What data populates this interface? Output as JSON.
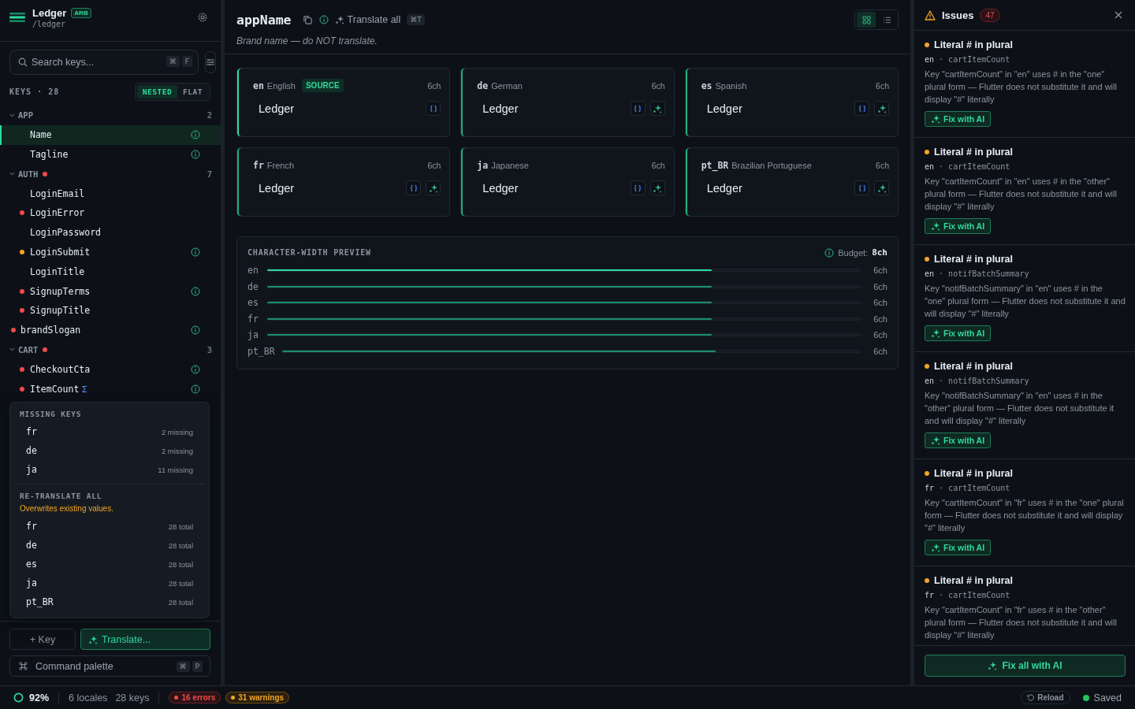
{
  "sidebar": {
    "app_name": "Ledger",
    "format_badge": "ARB",
    "path": "/ledger",
    "search": {
      "placeholder": "Search keys...",
      "shortcut": [
        "⌘",
        "F"
      ]
    },
    "keys_label": "KEYS · 28",
    "view_toggle": [
      {
        "label": "NESTED",
        "selected": true
      },
      {
        "label": "FLAT",
        "selected": false
      }
    ],
    "tree": [
      {
        "kind": "group",
        "label": "APP",
        "expanded": true,
        "count": "2",
        "children": [
          {
            "kind": "key",
            "label": "Name",
            "selected": true,
            "info": true
          },
          {
            "kind": "key",
            "label": "Tagline",
            "selected": false,
            "info": true
          }
        ]
      },
      {
        "kind": "group",
        "label": "AUTH",
        "expanded": true,
        "color": "#f04a4a",
        "count": "7",
        "children": [
          {
            "kind": "key",
            "label": "LoginEmail",
            "selected": false,
            "info": false
          },
          {
            "kind": "key",
            "label": "LoginError",
            "selected": false,
            "info": false,
            "color": "#f04a4a"
          },
          {
            "kind": "key",
            "label": "LoginPassword",
            "selected": false,
            "info": false
          },
          {
            "kind": "key",
            "label": "LoginSubmit",
            "selected": false,
            "info": true,
            "color": "#f5a524"
          },
          {
            "kind": "key",
            "label": "LoginTitle",
            "selected": false,
            "info": false
          },
          {
            "kind": "key",
            "label": "SignupTerms",
            "selected": false,
            "info": true,
            "color": "#f04a4a"
          },
          {
            "kind": "key",
            "label": "SignupTitle",
            "selected": false,
            "info": false,
            "color": "#f04a4a"
          }
        ]
      },
      {
        "kind": "key",
        "label": "brandSlogan",
        "selected": false,
        "info": true,
        "color": "#f04a4a"
      },
      {
        "kind": "group",
        "label": "CART",
        "expanded": true,
        "color": "#f04a4a",
        "count": "3",
        "children": [
          {
            "kind": "key",
            "label": "CheckoutCta",
            "selected": false,
            "info": true,
            "color": "#f04a4a"
          },
          {
            "kind": "key",
            "label": "ItemCount",
            "selected": false,
            "info": true,
            "color": "#f04a4a",
            "plural": true
          }
        ]
      }
    ],
    "translate_menu": {
      "missing_title": "MISSING KEYS",
      "missing": [
        {
          "locale": "fr",
          "note": "2 missing"
        },
        {
          "locale": "de",
          "note": "2 missing"
        },
        {
          "locale": "ja",
          "note": "11 missing"
        }
      ],
      "retranslate_title": "RE-TRANSLATE ALL",
      "warning": "Overwrites existing values.",
      "retranslate": [
        {
          "locale": "fr",
          "note": "28 total"
        },
        {
          "locale": "de",
          "note": "28 total"
        },
        {
          "locale": "es",
          "note": "28 total"
        },
        {
          "locale": "ja",
          "note": "28 total"
        },
        {
          "locale": "pt_BR",
          "note": "28 total"
        }
      ]
    },
    "add_key_button": "+ Key",
    "translate_button": "Translate...",
    "command_palette": {
      "label": "Command palette",
      "shortcut": [
        "⌘",
        "P"
      ]
    }
  },
  "main": {
    "key_name": "appName",
    "translate_all": "Translate all",
    "translate_shortcut": "⌘T",
    "description": "Brand name — do NOT translate.",
    "view_modes": [
      {
        "kind": "grid",
        "selected": true
      },
      {
        "kind": "list",
        "selected": false
      }
    ],
    "locales": [
      {
        "code": "en",
        "name": "English",
        "source": true,
        "badge": "SOURCE",
        "width": "6ch",
        "value": "Ledger"
      },
      {
        "code": "de",
        "name": "German",
        "source": false,
        "width": "6ch",
        "value": "Ledger"
      },
      {
        "code": "es",
        "name": "Spanish",
        "source": false,
        "width": "6ch",
        "value": "Ledger"
      },
      {
        "code": "fr",
        "name": "French",
        "source": false,
        "width": "6ch",
        "value": "Ledger"
      },
      {
        "code": "ja",
        "name": "Japanese",
        "source": false,
        "width": "6ch",
        "value": "Ledger"
      },
      {
        "code": "pt_BR",
        "name": "Brazilian Portuguese",
        "source": false,
        "width": "6ch",
        "value": "Ledger"
      }
    ],
    "preview": {
      "title": "CHARACTER-WIDTH PREVIEW",
      "budget_label": "Budget:",
      "budget": "8ch",
      "rows": [
        {
          "locale": "en",
          "source": true,
          "level": 0.75,
          "reading": "6ch"
        },
        {
          "locale": "de",
          "source": false,
          "level": 0.75,
          "reading": "6ch"
        },
        {
          "locale": "es",
          "source": false,
          "level": 0.75,
          "reading": "6ch"
        },
        {
          "locale": "fr",
          "source": false,
          "level": 0.75,
          "reading": "6ch"
        },
        {
          "locale": "ja",
          "source": false,
          "level": 0.75,
          "reading": "6ch"
        },
        {
          "locale": "pt_BR",
          "source": false,
          "level": 0.75,
          "reading": "6ch"
        }
      ]
    }
  },
  "issues": {
    "title": "Issues",
    "count": "47",
    "separator": "·",
    "items": [
      {
        "color": "#f5a524",
        "title": "Literal # in plural",
        "locale": "en",
        "key": "cartItemCount",
        "description": "Key \"cartItemCount\" in \"en\" uses # in the \"one\" plural form — Flutter does not substitute it and will display \"#\" literally",
        "button": "Fix with AI"
      },
      {
        "color": "#f5a524",
        "title": "Literal # in plural",
        "locale": "en",
        "key": "cartItemCount",
        "description": "Key \"cartItemCount\" in \"en\" uses # in the \"other\" plural form — Flutter does not substitute it and will display \"#\" literally",
        "button": "Fix with AI"
      },
      {
        "color": "#f5a524",
        "title": "Literal # in plural",
        "locale": "en",
        "key": "notifBatchSummary",
        "description": "Key \"notifBatchSummary\" in \"en\" uses # in the \"one\" plural form — Flutter does not substitute it and will display \"#\" literally",
        "button": "Fix with AI"
      },
      {
        "color": "#f5a524",
        "title": "Literal # in plural",
        "locale": "en",
        "key": "notifBatchSummary",
        "description": "Key \"notifBatchSummary\" in \"en\" uses # in the \"other\" plural form — Flutter does not substitute it and will display \"#\" literally",
        "button": "Fix with AI"
      },
      {
        "color": "#f5a524",
        "title": "Literal # in plural",
        "locale": "fr",
        "key": "cartItemCount",
        "description": "Key \"cartItemCount\" in \"fr\" uses # in the \"one\" plural form — Flutter does not substitute it and will display \"#\" literally",
        "button": "Fix with AI"
      },
      {
        "color": "#f5a524",
        "title": "Literal # in plural",
        "locale": "fr",
        "key": "cartItemCount",
        "description": "Key \"cartItemCount\" in \"fr\" uses # in the \"other\" plural form — Flutter does not substitute it and will display \"#\" literally"
      }
    ],
    "fix_all_button": "Fix all with AI"
  },
  "status_bar": {
    "progress": "92%",
    "locales": "6 locales",
    "keys": "28 keys",
    "errors": "16 errors",
    "warnings": "31 warnings",
    "reload_button": "Reload",
    "save_state": "Saved"
  }
}
